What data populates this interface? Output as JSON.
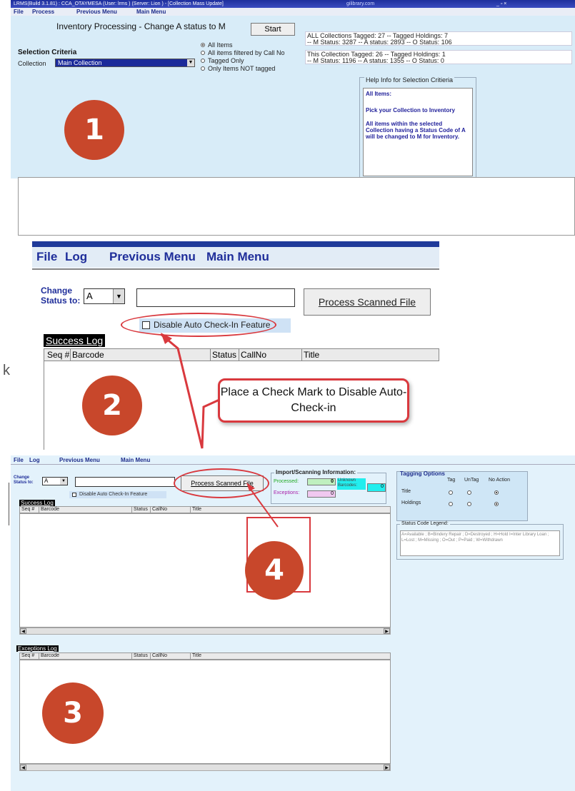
{
  "panel1": {
    "window_title": "LRMS(Build 3.1.81) : CCA_OTAYMESA (User: lrms ) (Server: Lion ) - [Collection Mass Update]",
    "window_url": "gilibrary.com",
    "window_controls": "_ ▫ ×",
    "menu": [
      "File",
      "Process",
      "Previous Menu",
      "Main Menu"
    ],
    "heading": "Inventory Processing - Change A status to M",
    "start_label": "Start",
    "all_collections_line1": "ALL Collections Tagged: 27 -- Tagged Holdings: 7",
    "all_collections_line2": "-- M Status: 3287 -- A status: 2893 -- O Status: 106",
    "this_collection_line1": "This Collection Tagged: 26 -- Tagged Holdings: 1",
    "this_collection_line2": "-- M Status: 1196 -- A status: 1355 -- O Status: 0",
    "selection_criteria": "Selection Criteria",
    "collection_label": "Collection",
    "collection_value": "Main Collection",
    "radio_options": [
      "All Items",
      "All items filtered by Call No",
      "Tagged Only",
      "Only Items NOT tagged"
    ],
    "help_title": "Help Info for Selection Critieria",
    "help_line1": "All Items:",
    "help_line2": "Pick your Collection to Inventory",
    "help_line3": "All items within the selected Collection having a Status Code of A will be changed to M for Inventory.",
    "step_number": "1"
  },
  "panel2": {
    "menu": [
      "File",
      "Log",
      "Previous Menu",
      "Main Menu"
    ],
    "change_status_label": "Change Status to:",
    "status_value": "A",
    "process_button": "Process Scanned File",
    "disable_checkbox_label": "Disable Auto Check-In Feature",
    "success_log": "Success Log",
    "columns": [
      "Seq #",
      "Barcode",
      "Status",
      "CallNo",
      "Title"
    ],
    "callout_text": "Place a Check Mark to Disable Auto-Check-in",
    "step_number": "2",
    "side_fragment": "k"
  },
  "panel3": {
    "menu": [
      "File",
      "Log",
      "Previous Menu",
      "Main Menu"
    ],
    "change_status_label": "Change Status to:",
    "status_value": "A",
    "process_button": "Process Scanned File",
    "disable_checkbox_label": "Disable Auto Check-In Feature",
    "import_title": "Import/Scanning Information:",
    "processed_label": "Processed:",
    "processed_value": "0",
    "exceptions_label": "Exceptions:",
    "exceptions_value": "0",
    "unknown_label": "Unknown Barcodes:",
    "unknown_value": "0",
    "tagging_title": "Tagging Options",
    "tagging_cols": [
      "Tag",
      "UnTag",
      "No Action"
    ],
    "tagging_rows": [
      "Title",
      "Holdings"
    ],
    "legend_title": "Status Code Legend:",
    "legend_text": "A=Available ; B=Bindery Repair ; D=Destroyed ; H=Hold I=Inter Library Loan ; L=Lost ; M=Missing ; O=Out ; P=Paid ; W=Withdrawn",
    "success_log": "Success Log",
    "exceptions_log": "Exceptions Log",
    "columns": [
      "Seq #",
      "Barcode",
      "Status",
      "CallNo",
      "Title"
    ],
    "step_number_log": "3",
    "step_number_button": "4"
  },
  "colors": {
    "step_circle": "#c8472b",
    "callout_red": "#d9393e",
    "title_blue": "#1f2e8c"
  }
}
